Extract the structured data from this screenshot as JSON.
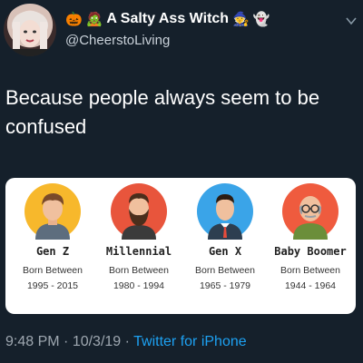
{
  "header": {
    "display_name": "A Salty Ass Witch",
    "handle": "@CheerstoLiving",
    "icons": [
      "pumpkin-icon",
      "mummy-icon",
      "witch-icon",
      "ghost-icon"
    ]
  },
  "tweet": {
    "text": "Because people always seem to be confused"
  },
  "generations": [
    {
      "name": "Gen Z",
      "born_label": "Born Between",
      "years": "1995 - 2015",
      "color": "#f7b82c"
    },
    {
      "name": "Millennial",
      "born_label": "Born Between",
      "years": "1980 - 1994",
      "color": "#e8553c"
    },
    {
      "name": "Gen X",
      "born_label": "Born Between",
      "years": "1965 - 1979",
      "color": "#3aa4e8"
    },
    {
      "name": "Baby Boomer",
      "born_label": "Born Between",
      "years": "1944 - 1964",
      "color": "#ef5b3e"
    }
  ],
  "footer": {
    "time": "9:48 PM",
    "separator1": " · ",
    "date": "10/3/19",
    "separator2": " · ",
    "source": "Twitter for iPhone"
  },
  "colors": {
    "background": "#15202b",
    "link": "#1da1f2",
    "muted": "#9ea7b0"
  }
}
